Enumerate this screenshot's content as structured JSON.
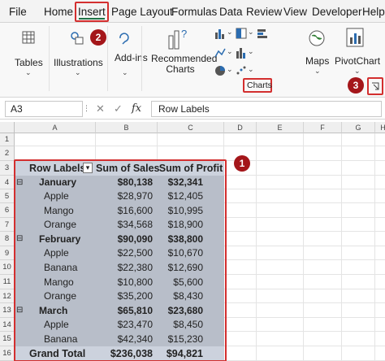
{
  "ribbon_tabs": [
    "File",
    "Home",
    "Insert",
    "Page Layout",
    "Formulas",
    "Data",
    "Review",
    "View",
    "Developer",
    "Help"
  ],
  "active_tab": "Insert",
  "ribbon": {
    "tables_label": "Tables",
    "illustrations_label": "Illustrations",
    "addins_label": "Add-ins",
    "recommended_charts_label": "Recommended Charts",
    "charts_group_label": "Charts",
    "maps_label": "Maps",
    "pivotchart_label": "PivotChart"
  },
  "callouts": {
    "c1": "1",
    "c2": "2",
    "c3": "3"
  },
  "formula_bar": {
    "name_box": "A3",
    "fx_symbol": "fx",
    "value": "Row Labels"
  },
  "columns": [
    "A",
    "B",
    "C",
    "D",
    "E",
    "F",
    "G",
    "H"
  ],
  "row_numbers": [
    "1",
    "2",
    "3",
    "4",
    "5",
    "6",
    "7",
    "8",
    "9",
    "10",
    "11",
    "12",
    "13",
    "14",
    "15",
    "16"
  ],
  "pivot": {
    "headers": [
      "Row Labels",
      "Sum of Sales",
      "Sum of Profit"
    ],
    "rows": [
      {
        "label": "January",
        "sales": "$80,138",
        "profit": "$32,341",
        "kind": "group"
      },
      {
        "label": "Apple",
        "sales": "$28,970",
        "profit": "$12,405",
        "kind": "item"
      },
      {
        "label": "Mango",
        "sales": "$16,600",
        "profit": "$10,995",
        "kind": "item"
      },
      {
        "label": "Orange",
        "sales": "$34,568",
        "profit": "$18,900",
        "kind": "item"
      },
      {
        "label": "February",
        "sales": "$90,090",
        "profit": "$38,800",
        "kind": "group"
      },
      {
        "label": "Apple",
        "sales": "$22,500",
        "profit": "$10,670",
        "kind": "item"
      },
      {
        "label": "Banana",
        "sales": "$22,380",
        "profit": "$12,690",
        "kind": "item"
      },
      {
        "label": "Mango",
        "sales": "$10,800",
        "profit": "$5,600",
        "kind": "item"
      },
      {
        "label": "Orange",
        "sales": "$35,200",
        "profit": "$8,430",
        "kind": "item"
      },
      {
        "label": "March",
        "sales": "$65,810",
        "profit": "$23,680",
        "kind": "group"
      },
      {
        "label": "Apple",
        "sales": "$23,470",
        "profit": "$8,450",
        "kind": "item"
      },
      {
        "label": "Banana",
        "sales": "$42,340",
        "profit": "$15,230",
        "kind": "item"
      }
    ],
    "grand_total": {
      "label": "Grand Total",
      "sales": "$236,038",
      "profit": "$94,821"
    }
  },
  "colors": {
    "accent_red": "#d32f2f",
    "callout": "#a4161a",
    "excel_green": "#217346",
    "pivot_fill": "#b8bec9",
    "header_fill": "#ccd2dd"
  }
}
